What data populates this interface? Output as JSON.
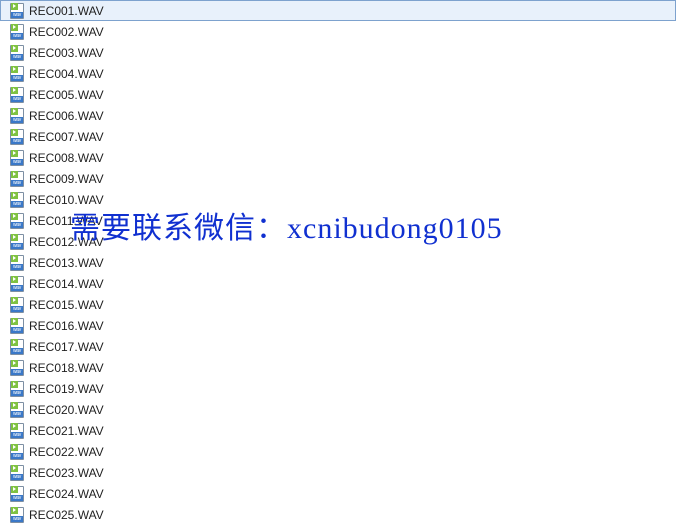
{
  "selected_index": 0,
  "icon_label": "wav",
  "watermark": "需要联系微信：xcnibudong0105",
  "files": [
    {
      "name": "REC001.WAV"
    },
    {
      "name": "REC002.WAV"
    },
    {
      "name": "REC003.WAV"
    },
    {
      "name": "REC004.WAV"
    },
    {
      "name": "REC005.WAV"
    },
    {
      "name": "REC006.WAV"
    },
    {
      "name": "REC007.WAV"
    },
    {
      "name": "REC008.WAV"
    },
    {
      "name": "REC009.WAV"
    },
    {
      "name": "REC010.WAV"
    },
    {
      "name": "REC011.WAV"
    },
    {
      "name": "REC012.WAV"
    },
    {
      "name": "REC013.WAV"
    },
    {
      "name": "REC014.WAV"
    },
    {
      "name": "REC015.WAV"
    },
    {
      "name": "REC016.WAV"
    },
    {
      "name": "REC017.WAV"
    },
    {
      "name": "REC018.WAV"
    },
    {
      "name": "REC019.WAV"
    },
    {
      "name": "REC020.WAV"
    },
    {
      "name": "REC021.WAV"
    },
    {
      "name": "REC022.WAV"
    },
    {
      "name": "REC023.WAV"
    },
    {
      "name": "REC024.WAV"
    },
    {
      "name": "REC025.WAV"
    }
  ]
}
